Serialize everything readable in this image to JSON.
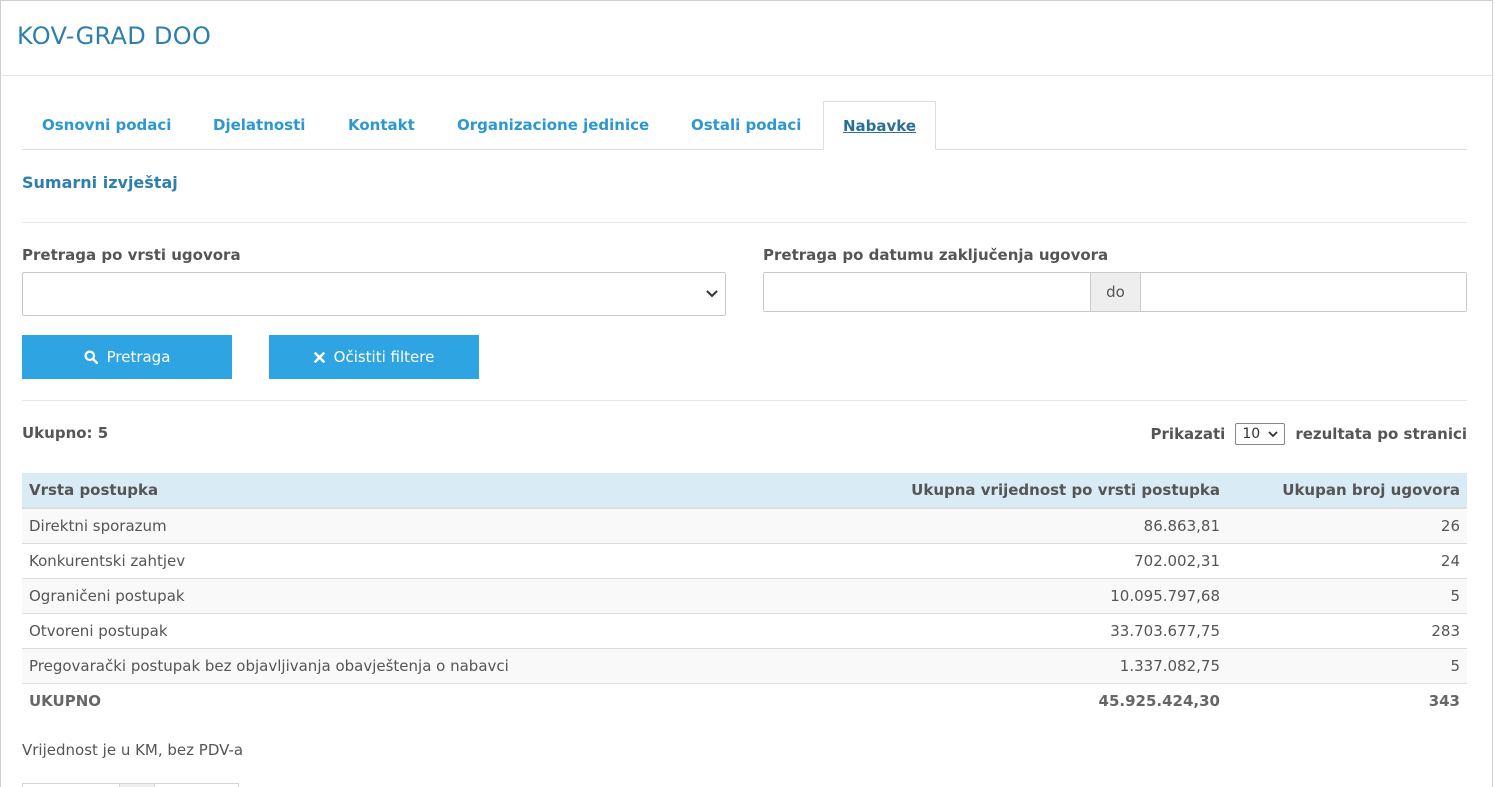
{
  "header": {
    "company": "KOV-GRAD DOO"
  },
  "tabs": [
    {
      "label": "Osnovni podaci"
    },
    {
      "label": "Djelatnosti"
    },
    {
      "label": "Kontakt"
    },
    {
      "label": "Organizacione jedinice"
    },
    {
      "label": "Ostali podaci"
    },
    {
      "label": "Nabavke",
      "active": true
    }
  ],
  "section": {
    "title": "Sumarni izvještaj"
  },
  "filters": {
    "contract_type_label": "Pretraga po vrsti ugovora",
    "contract_type_value": "",
    "date_label": "Pretraga po datumu zaključenja ugovora",
    "date_from": "",
    "date_separator": "do",
    "date_to": ""
  },
  "buttons": {
    "search": "Pretraga",
    "clear": "Očistiti filtere"
  },
  "results": {
    "total_label": "Ukupno: 5",
    "show_label": "Prikazati",
    "per_page": "10",
    "per_page_suffix": "rezultata po stranici"
  },
  "table": {
    "headers": [
      "Vrsta postupka",
      "Ukupna vrijednost po vrsti postupka",
      "Ukupan broj ugovora"
    ],
    "rows": [
      [
        "Direktni sporazum",
        "86.863,81",
        "26"
      ],
      [
        "Konkurentski zahtjev",
        "702.002,31",
        "24"
      ],
      [
        "Ograničeni postupak",
        "10.095.797,68",
        "5"
      ],
      [
        "Otvoreni postupak",
        "33.703.677,75",
        "283"
      ],
      [
        "Pregovarački postupak bez objavljivanja obavještenja o nabavci",
        "1.337.082,75",
        "5"
      ]
    ],
    "total": [
      "UKUPNO",
      "45.925.424,30",
      "343"
    ]
  },
  "note": "Vrijednost je u KM, bez PDV-a",
  "colors": {
    "accent": "#2ea4e3",
    "title": "#2f7fad",
    "table_header": "#d9ebf5"
  },
  "icons": {
    "search": "search-icon",
    "clear": "close-icon",
    "dropdown": "chevron-down-icon"
  }
}
